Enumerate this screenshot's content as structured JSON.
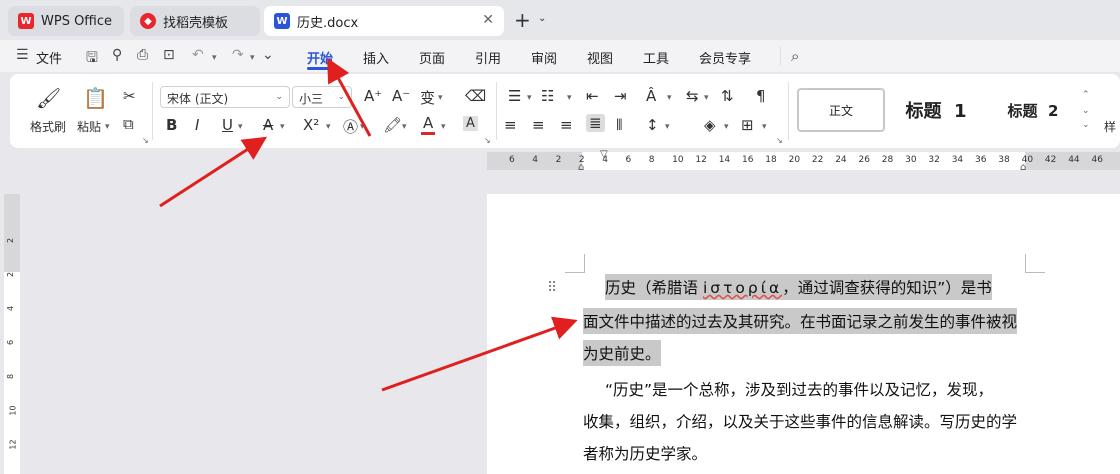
{
  "tabs": [
    {
      "label": "WPS Office",
      "icon": "wps-logo-icon"
    },
    {
      "label": "找稻壳模板",
      "icon": "docer-logo-icon"
    },
    {
      "label": "历史.docx",
      "icon": "word-doc-icon",
      "active": true
    }
  ],
  "menu": {
    "file": "文件",
    "items": [
      "开始",
      "插入",
      "页面",
      "引用",
      "审阅",
      "视图",
      "工具",
      "会员专享"
    ],
    "active_index": 0
  },
  "ribbon": {
    "format_painter": "格式刷",
    "paste": "粘贴",
    "font_name": "宋体 (正文)",
    "font_size": "小三",
    "styles": [
      "正文",
      "标题  1",
      "标题  2"
    ],
    "styles_more": "样"
  },
  "ruler": {
    "h_numbers": [
      "6",
      "4",
      "2",
      "2",
      "4",
      "6",
      "8",
      "10",
      "12",
      "14",
      "16",
      "18",
      "20",
      "22",
      "24",
      "26",
      "28",
      "30",
      "32",
      "34",
      "36",
      "38",
      "40",
      "42",
      "44",
      "46"
    ],
    "v_numbers": [
      "2",
      "2",
      "4",
      "6",
      "8",
      "10",
      "12"
    ]
  },
  "document": {
    "p1_line1_a": "历史（希腊语 ",
    "p1_greek": "iστορία",
    "p1_line1_b": "，通过调查获得的知识”）是书",
    "p1_line2": "面文件中描述的过去及其研究。在书面记录之前发生的事件被视",
    "p1_line3": "为史前史。",
    "p2_line1": "“历史”是一个总称，涉及到过去的事件以及记忆，发现，",
    "p2_line2": "收集，组织，介绍，以及关于这些事件的信息解读。写历史的学",
    "p2_line3": "者称为历史学家。"
  },
  "colors": {
    "accent": "#2b55d9",
    "highlight": "#c9c9c9",
    "arrow": "#e0201e",
    "wps_red": "#e8262b",
    "font_color_bar": "#d22b2b"
  }
}
